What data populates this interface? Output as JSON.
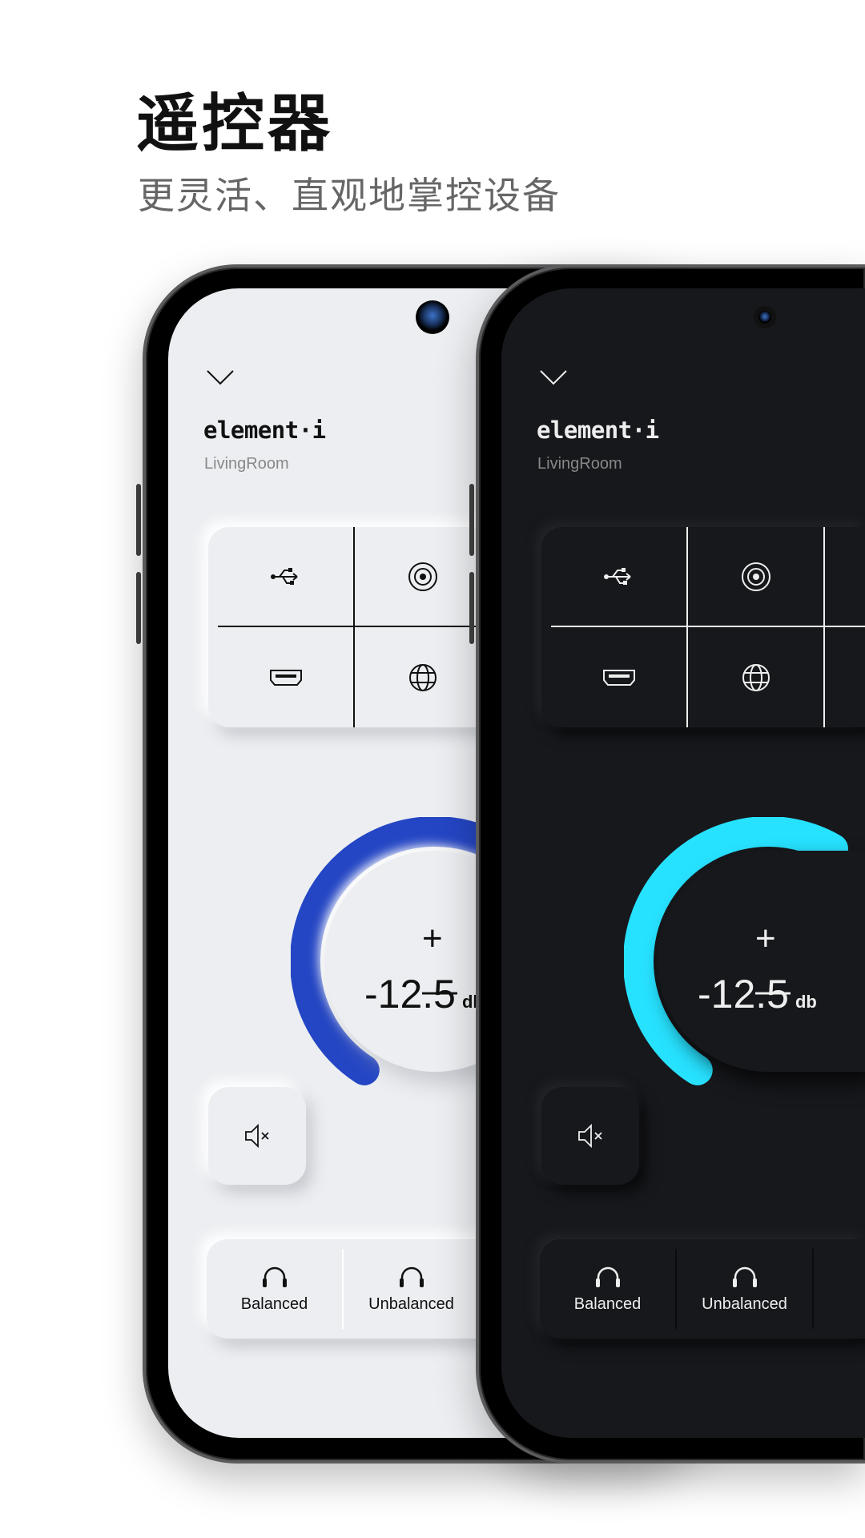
{
  "header": {
    "title": "遥控器",
    "subtitle": "更灵活、直观地掌控设备"
  },
  "device": {
    "brand": "element·i",
    "room": "LivingRoom"
  },
  "inputs": [
    {
      "icon": "usb-icon"
    },
    {
      "icon": "optical-icon"
    },
    {
      "icon": "hdmi-icon"
    },
    {
      "icon": "network-globe-icon"
    }
  ],
  "volume": {
    "value": "-12.5",
    "unit": "db",
    "plus": "+",
    "minus": "—"
  },
  "outputs": [
    {
      "label": "Balanced",
      "icon": "headphones-icon"
    },
    {
      "label": "Unbalanced",
      "icon": "headphones-icon"
    }
  ],
  "colors": {
    "light_accent": "#2446c4",
    "dark_accent": "#27e2ff",
    "light_bg": "#eceef1",
    "dark_bg": "#17181c"
  }
}
